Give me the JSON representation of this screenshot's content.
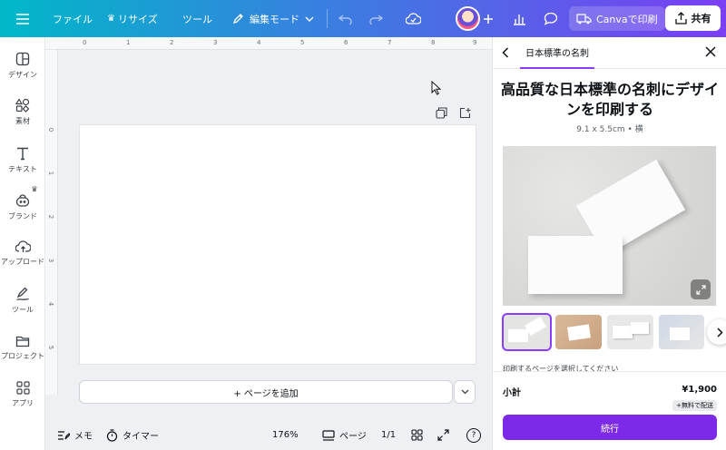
{
  "topbar": {
    "file": "ファイル",
    "resize": "リサイズ",
    "tools": "ツール",
    "edit_mode": "編集モード",
    "print": "Canvaで印刷",
    "share": "共有"
  },
  "leftrail": [
    {
      "label": "デザイン",
      "icon": "design-icon"
    },
    {
      "label": "素材",
      "icon": "elements-icon"
    },
    {
      "label": "テキスト",
      "icon": "text-icon"
    },
    {
      "label": "ブランド",
      "icon": "brand-icon"
    },
    {
      "label": "アップロード",
      "icon": "upload-icon"
    },
    {
      "label": "ツール",
      "icon": "draw-icon"
    },
    {
      "label": "プロジェクト",
      "icon": "folder-icon"
    },
    {
      "label": "アプリ",
      "icon": "apps-icon"
    }
  ],
  "ruler": {
    "top": [
      "0",
      "1",
      "2",
      "3",
      "4",
      "5",
      "6",
      "7",
      "8",
      "9"
    ],
    "left": [
      "0",
      "1",
      "2",
      "3",
      "4",
      "5"
    ]
  },
  "canvas": {
    "add_page": "+ ページを追加"
  },
  "bottom": {
    "notes": "メモ",
    "timer": "タイマー",
    "zoom": "176%",
    "pages": "ページ",
    "page_count": "1/1",
    "help": "?"
  },
  "panel": {
    "tab": "日本標準の名刺",
    "title": "高品質な日本標準の名刺にデザインを印刷する",
    "subtitle": "9.1 x 5.5cm • 横",
    "section_label": "印刷するページを選択してください",
    "subtotal_label": "小計",
    "subtotal_price": "¥1,900",
    "shipping_badge": "+無料で配送",
    "continue": "続行"
  },
  "colors": {
    "accent": "#7d2ae8",
    "gradient_start": "#00b8c8",
    "gradient_end": "#7a3ff2"
  }
}
